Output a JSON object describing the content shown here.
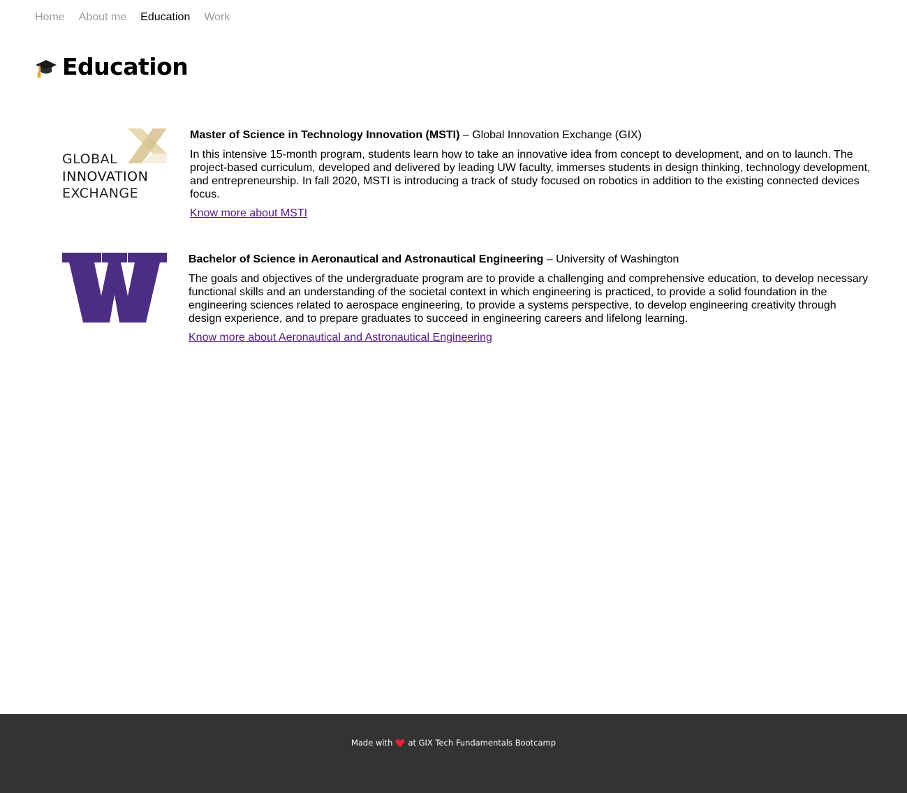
{
  "nav": {
    "items": [
      {
        "label": "Home"
      },
      {
        "label": "About me"
      },
      {
        "label": "Education"
      },
      {
        "label": "Work"
      }
    ],
    "active": "Education"
  },
  "page": {
    "icon": "graduation-cap-icon",
    "title": "Education"
  },
  "education": [
    {
      "logo": "gix-logo",
      "logo_text": [
        "GLOBAL",
        "INNOVATION",
        "EXCHANGE"
      ],
      "degree": "Master of Science in Technology Innovation (MSTI)",
      "separator": " – ",
      "institution": "Global Innovation Exchange (GIX)",
      "description": "In this intensive 15-month program, students learn how to take an innovative idea from concept to development, and on to launch. The project-based curriculum, developed and delivered by leading UW faculty, immerses students in design thinking, technology development, and entrepreneurship. In fall 2020, MSTI is introducing a track of study focused on robotics in addition to the existing connected devices focus.",
      "link_text": "Know more about MSTI"
    },
    {
      "logo": "uw-w-logo",
      "degree": "Bachelor of Science in Aeronautical and Astronautical Engineering",
      "separator": " – ",
      "institution": "University of Washington",
      "description": "The goals and objectives of the undergraduate program are to provide a challenging and comprehensive education, to develop necessary functional skills and an understanding of the societal context in which engineering is practiced, to provide a solid foundation in the engineering sciences related to aerospace engineering, to provide a systems perspective, to develop engineering creativity through design experience, and to prepare graduates to succeed in engineering careers and lifelong learning.",
      "link_text": "Know more about Aeronautical and Astronautical Engineering"
    }
  ],
  "footer": {
    "text_before": "Made with",
    "icon": "heart-icon",
    "text_after": "at GIX Tech Fundamentals Bootcamp"
  },
  "colors": {
    "nav_inactive": "#9a9a9a",
    "link": "#551a8b",
    "uw_purple": "#4b2e83",
    "gix_gold": "#e8d9b0",
    "footer_bg": "#333333"
  }
}
